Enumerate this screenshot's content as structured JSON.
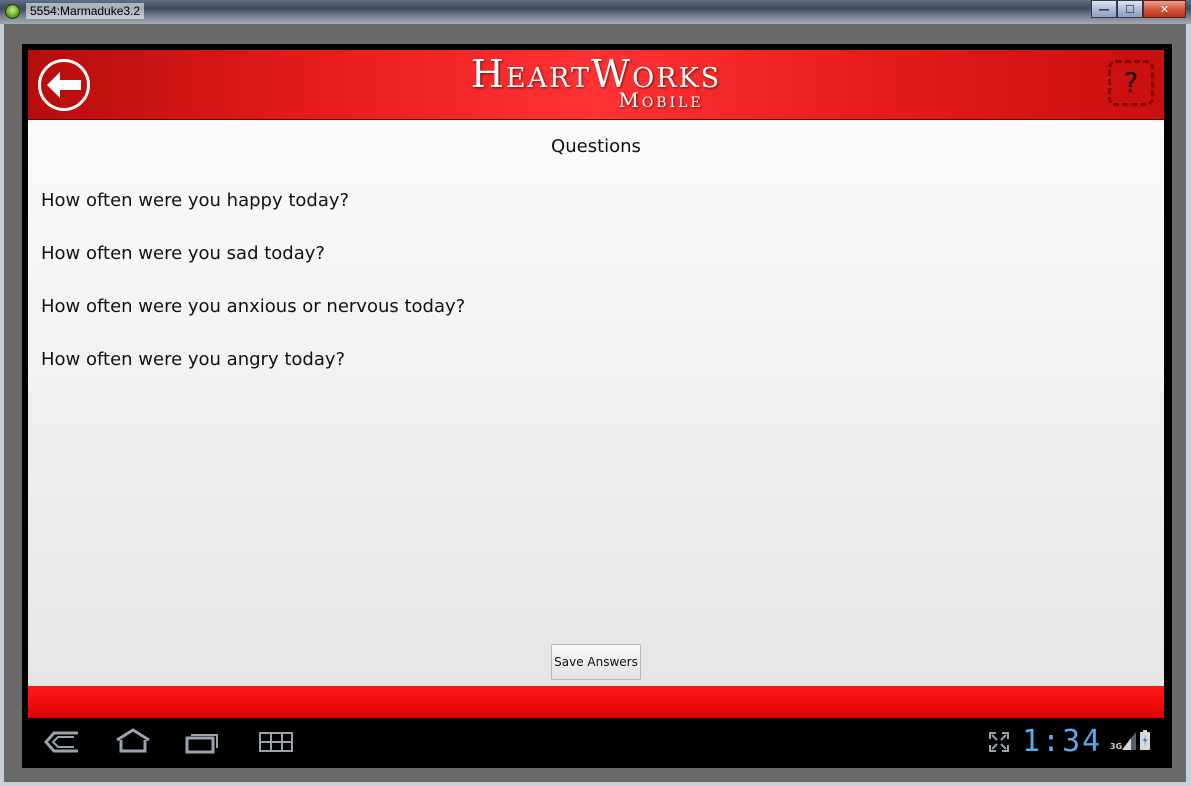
{
  "window": {
    "title": "5554:Marmaduke3.2",
    "minimize_label": "—",
    "maximize_label": "☐",
    "close_label": "✕"
  },
  "header": {
    "brand_title": "HeartWorks",
    "brand_subtitle": "Mobile",
    "help_label": "?"
  },
  "main": {
    "section_title": "Questions",
    "questions": [
      "How often were you happy today?",
      "How often were you sad today?",
      "How often were you anxious or nervous today?",
      "How often were you angry today?"
    ],
    "save_label": "Save Answers"
  },
  "system_bar": {
    "time": "1:34",
    "network": "3G",
    "icons": [
      "back-icon",
      "home-icon",
      "recent-apps-icon",
      "menu-grid-icon",
      "screen-compat-icon",
      "signal-icon",
      "battery-icon"
    ]
  },
  "colors": {
    "header_red": "#e61b1b",
    "footer_red": "#e00000",
    "clock_blue": "#5ea6e6",
    "content_bg": "#f2f2f2"
  }
}
